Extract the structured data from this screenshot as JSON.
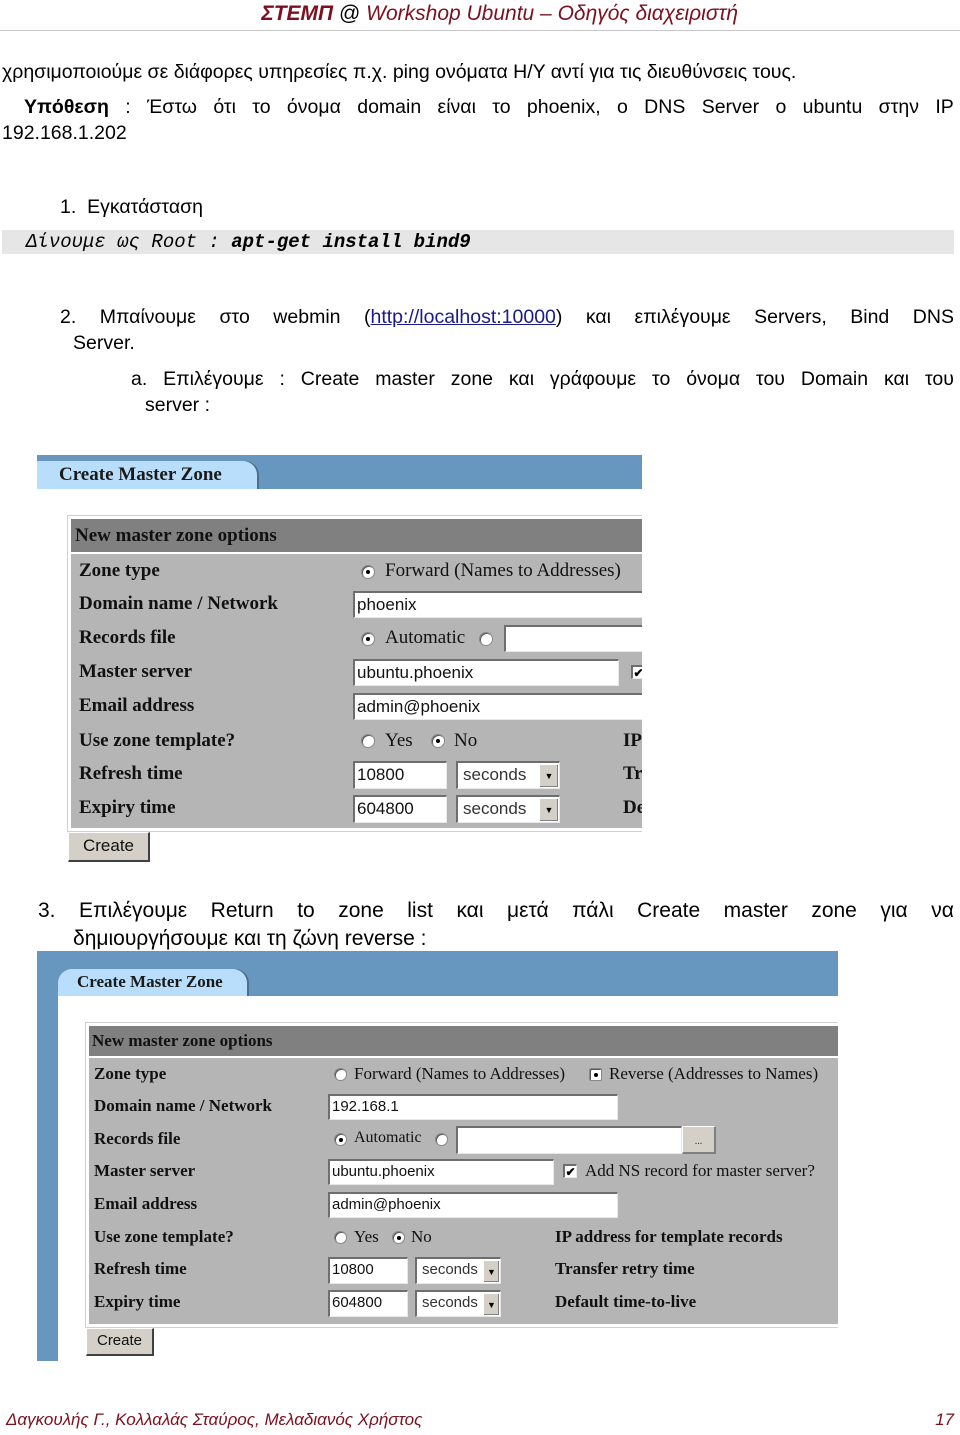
{
  "header": {
    "brand": "ΣΤΕΜΠ",
    "at": "@",
    "title": "Workshop Ubuntu – Οδηγός διαχειριστή"
  },
  "body": {
    "intro_line": "χρησιμοποιούμε σε διάφορες υπηρεσίες π.χ. ping ονόματα Η/Υ αντί για τις διευθύνσεις τους.",
    "hypothesis_label": "Υπόθεση",
    "hypothesis_line1_words": [
      ":",
      "Έστω",
      "ότι",
      "το",
      "όνομα",
      "domain",
      "είναι",
      "το",
      "phoenix,",
      "ο",
      "DNS",
      "Server",
      "ο",
      "ubuntu",
      "στην",
      "IP"
    ],
    "hypothesis_line2": "192.168.1.202",
    "step1": {
      "number": "1.",
      "title": "Εγκατάσταση"
    },
    "code": {
      "prefix": "Δίνουμε ως Root : ",
      "command": "apt-get install bind9"
    },
    "step2": {
      "number": "2.",
      "line1_pre_words": [
        "Μπαίνουμε",
        "στο",
        "webmin"
      ],
      "link_open": "(",
      "link": "http://localhost:10000",
      "link_close": ")",
      "line1_post_words": [
        "και",
        "επιλέγουμε",
        "Servers,",
        "Bind",
        "DNS"
      ],
      "line2": "Server."
    },
    "step2a": {
      "letter": "a.",
      "line1_words": [
        "Επιλέγουμε",
        ":",
        "Create",
        "master",
        "zone",
        "και",
        "γράφουμε",
        "το",
        "όνομα",
        "του",
        "Domain",
        "και",
        "του"
      ],
      "line2": "server :"
    },
    "step3": {
      "number": "3.",
      "line1_words": [
        "Επιλέγουμε",
        "Return",
        "to",
        "zone",
        "list",
        "και",
        "μετά",
        "πάλι",
        "Create",
        "master",
        "zone",
        "για",
        "να"
      ],
      "line2": "δημιουργήσουμε και τη ζώνη reverse :"
    }
  },
  "forward_zone_form": {
    "tab_title": "Create Master Zone",
    "section_title": "New master zone options",
    "zone_type": {
      "label": "Zone type",
      "forward_label": "Forward (Names to Addresses)",
      "forward_selected": true
    },
    "domain": {
      "label": "Domain name / Network",
      "value": "phoenix"
    },
    "records_file": {
      "label": "Records file",
      "automatic_label": "Automatic",
      "automatic_selected": true,
      "custom_value": ""
    },
    "master_server": {
      "label": "Master server",
      "value": "ubuntu.phoenix",
      "add_ns_checked": true
    },
    "email": {
      "label": "Email address",
      "value": "admin@phoenix"
    },
    "template": {
      "label": "Use zone template?",
      "yes_label": "Yes",
      "no_label": "No",
      "selected": "No",
      "right_label_partial": "IP"
    },
    "refresh": {
      "label": "Refresh time",
      "value": "10800",
      "unit": "seconds",
      "right_label_partial": "Tr"
    },
    "expiry": {
      "label": "Expiry time",
      "value": "604800",
      "unit": "seconds",
      "right_label_partial": "De"
    },
    "create_button": "Create"
  },
  "reverse_zone_form": {
    "tab_title": "Create Master Zone",
    "section_title": "New master zone options",
    "zone_type": {
      "label": "Zone type",
      "forward_label": "Forward (Names to Addresses)",
      "reverse_label": "Reverse (Addresses to Names)",
      "selected": "Reverse"
    },
    "domain": {
      "label": "Domain name / Network",
      "value": "192.168.1"
    },
    "records_file": {
      "label": "Records file",
      "automatic_label": "Automatic",
      "automatic_selected": true,
      "custom_value": "",
      "browse_label": "..."
    },
    "master_server": {
      "label": "Master server",
      "value": "ubuntu.phoenix",
      "add_ns_label": "Add NS record for master server?",
      "add_ns_checked": true
    },
    "email": {
      "label": "Email address",
      "value": "admin@phoenix"
    },
    "template": {
      "label": "Use zone template?",
      "yes_label": "Yes",
      "no_label": "No",
      "selected": "No",
      "ip_label": "IP address for template records"
    },
    "refresh": {
      "label": "Refresh time",
      "value": "10800",
      "unit": "seconds",
      "right_label": "Transfer retry time"
    },
    "expiry": {
      "label": "Expiry time",
      "value": "604800",
      "unit": "seconds",
      "right_label": "Default time-to-live"
    },
    "create_button": "Create"
  },
  "footer": {
    "authors": "Δαγκουλής Γ., Κολλαλάς Σταύρος, Μελαδιανός Χρήστος",
    "page_number": "17"
  }
}
